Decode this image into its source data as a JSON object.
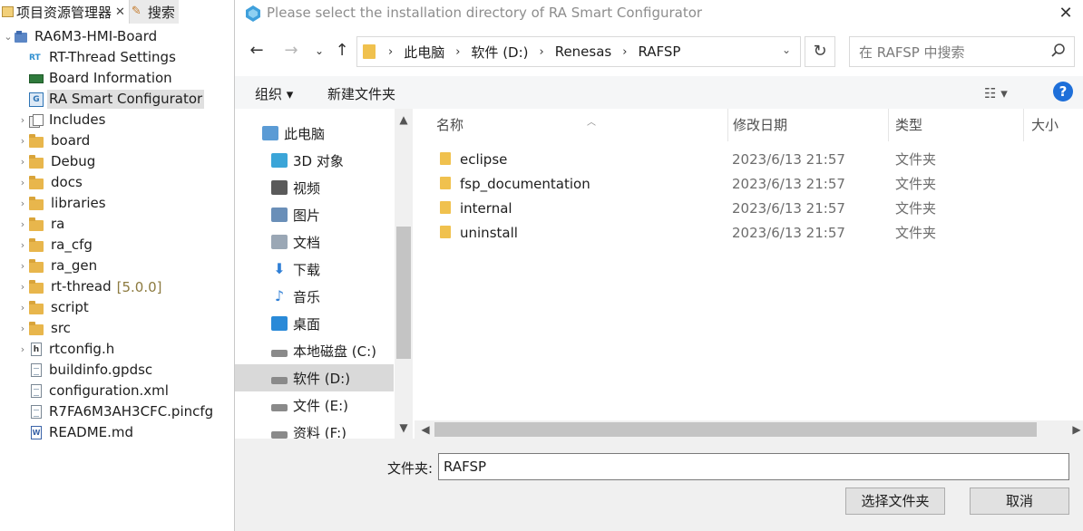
{
  "explorer": {
    "tabs": [
      {
        "label": "项目资源管理器",
        "close": "✕"
      },
      {
        "label": "搜索"
      }
    ],
    "project": "RA6M3-HMI-Board",
    "items": [
      {
        "label": "RT-Thread Settings",
        "icon": "rt-thread-icon"
      },
      {
        "label": "Board Information",
        "icon": "board-icon"
      },
      {
        "label": "RA Smart Configurator",
        "icon": "ra-configurator-icon",
        "selected": true
      },
      {
        "label": "Includes",
        "icon": "includes-icon",
        "expandable": true
      },
      {
        "label": "board",
        "icon": "folder-icon",
        "expandable": true
      },
      {
        "label": "Debug",
        "icon": "folder-icon",
        "expandable": true
      },
      {
        "label": "docs",
        "icon": "folder-icon",
        "expandable": true
      },
      {
        "label": "libraries",
        "icon": "folder-icon",
        "expandable": true
      },
      {
        "label": "ra",
        "icon": "folder-icon",
        "expandable": true
      },
      {
        "label": "ra_cfg",
        "icon": "folder-icon",
        "expandable": true
      },
      {
        "label": "ra_gen",
        "icon": "folder-icon",
        "expandable": true
      },
      {
        "label": "rt-thread",
        "version": "[5.0.0]",
        "icon": "folder-icon",
        "expandable": true
      },
      {
        "label": "script",
        "icon": "folder-icon",
        "expandable": true
      },
      {
        "label": "src",
        "icon": "folder-icon",
        "expandable": true
      },
      {
        "label": "rtconfig.h",
        "icon": "header-file-icon",
        "expandable": true
      },
      {
        "label": "buildinfo.gpdsc",
        "icon": "file-icon"
      },
      {
        "label": "configuration.xml",
        "icon": "file-icon"
      },
      {
        "label": "R7FA6M3AH3CFC.pincfg",
        "icon": "file-icon"
      },
      {
        "label": "README.md",
        "icon": "markdown-file-icon"
      }
    ]
  },
  "dialog": {
    "title": "Please select the installation directory of RA Smart Configurator",
    "close": "✕",
    "breadcrumb": [
      "此电脑",
      "软件 (D:)",
      "Renesas",
      "RAFSP"
    ],
    "search_placeholder": "在 RAFSP 中搜索",
    "toolbar": {
      "organize": "组织 ▾",
      "new_folder": "新建文件夹"
    },
    "nav_items": [
      {
        "label": "此电脑",
        "icon": "this-pc-icon"
      },
      {
        "label": "3D 对象",
        "icon": "3d-objects-icon"
      },
      {
        "label": "视频",
        "icon": "videos-icon"
      },
      {
        "label": "图片",
        "icon": "pictures-icon"
      },
      {
        "label": "文档",
        "icon": "documents-icon"
      },
      {
        "label": "下载",
        "icon": "downloads-icon"
      },
      {
        "label": "音乐",
        "icon": "music-icon"
      },
      {
        "label": "桌面",
        "icon": "desktop-icon"
      },
      {
        "label": "本地磁盘 (C:)",
        "icon": "drive-icon"
      },
      {
        "label": "软件 (D:)",
        "icon": "drive-icon",
        "selected": true
      },
      {
        "label": "文件 (E:)",
        "icon": "drive-icon"
      },
      {
        "label": "资料 (F:)",
        "icon": "drive-icon"
      }
    ],
    "columns": [
      "名称",
      "修改日期",
      "类型",
      "大小"
    ],
    "files": [
      {
        "name": "eclipse",
        "date": "2023/6/13 21:57",
        "type": "文件夹"
      },
      {
        "name": "fsp_documentation",
        "date": "2023/6/13 21:57",
        "type": "文件夹"
      },
      {
        "name": "internal",
        "date": "2023/6/13 21:57",
        "type": "文件夹"
      },
      {
        "name": "uninstall",
        "date": "2023/6/13 21:57",
        "type": "文件夹"
      }
    ],
    "folder_label": "文件夹:",
    "folder_value": "RAFSP",
    "select_button": "选择文件夹",
    "cancel_button": "取消"
  },
  "colors": {
    "selection": "#e0e0e0",
    "folder": "#f0c14e",
    "accent": "#1e6fd9"
  }
}
